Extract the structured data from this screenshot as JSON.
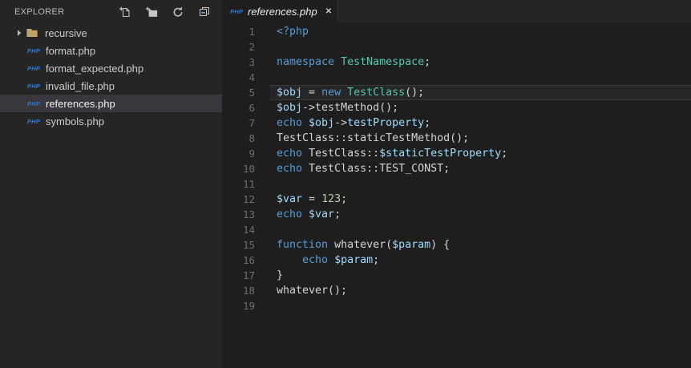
{
  "sidebar": {
    "title": "EXPLORER",
    "php_badge": "PHP",
    "actions": [
      {
        "name": "new-file"
      },
      {
        "name": "new-folder"
      },
      {
        "name": "refresh"
      },
      {
        "name": "collapse-all"
      }
    ],
    "files": [
      {
        "label": "recursive",
        "type": "folder",
        "expanded": false,
        "selected": false
      },
      {
        "label": "format.php",
        "type": "php",
        "selected": false
      },
      {
        "label": "format_expected.php",
        "type": "php",
        "selected": false
      },
      {
        "label": "invalid_file.php",
        "type": "php",
        "selected": false
      },
      {
        "label": "references.php",
        "type": "php",
        "selected": true
      },
      {
        "label": "symbols.php",
        "type": "php",
        "selected": false
      }
    ]
  },
  "tabbar": {
    "tabs": [
      {
        "icon": "PHP",
        "title": "references.php",
        "close": "✕",
        "active": true
      }
    ]
  },
  "editor": {
    "language": "php",
    "current_line": 5,
    "lines": [
      {
        "num": 1,
        "tokens": [
          {
            "c": "keyword",
            "t": "<?php"
          }
        ]
      },
      {
        "num": 2,
        "tokens": []
      },
      {
        "num": 3,
        "tokens": [
          {
            "c": "keyword",
            "t": "namespace "
          },
          {
            "c": "class",
            "t": "TestNamespace"
          },
          {
            "c": "foreground",
            "t": ";"
          }
        ]
      },
      {
        "num": 4,
        "tokens": []
      },
      {
        "num": 5,
        "tokens": [
          {
            "c": "variable",
            "t": "$obj"
          },
          {
            "c": "foreground",
            "t": " = "
          },
          {
            "c": "keyword",
            "t": "new "
          },
          {
            "c": "class",
            "t": "TestClass"
          },
          {
            "c": "foreground",
            "t": "();"
          }
        ]
      },
      {
        "num": 6,
        "tokens": [
          {
            "c": "variable",
            "t": "$obj"
          },
          {
            "c": "foreground",
            "t": "->testMethod();"
          }
        ]
      },
      {
        "num": 7,
        "tokens": [
          {
            "c": "keyword",
            "t": "echo "
          },
          {
            "c": "variable",
            "t": "$obj"
          },
          {
            "c": "foreground",
            "t": "->"
          },
          {
            "c": "variable",
            "t": "testProperty"
          },
          {
            "c": "foreground",
            "t": ";"
          }
        ]
      },
      {
        "num": 8,
        "tokens": [
          {
            "c": "foreground",
            "t": "TestClass::staticTestMethod();"
          }
        ]
      },
      {
        "num": 9,
        "tokens": [
          {
            "c": "keyword",
            "t": "echo "
          },
          {
            "c": "foreground",
            "t": "TestClass::"
          },
          {
            "c": "variable",
            "t": "$staticTestProperty"
          },
          {
            "c": "foreground",
            "t": ";"
          }
        ]
      },
      {
        "num": 10,
        "tokens": [
          {
            "c": "keyword",
            "t": "echo "
          },
          {
            "c": "foreground",
            "t": "TestClass::TEST_CONST;"
          }
        ]
      },
      {
        "num": 11,
        "tokens": []
      },
      {
        "num": 12,
        "tokens": [
          {
            "c": "variable",
            "t": "$var"
          },
          {
            "c": "foreground",
            "t": " = "
          },
          {
            "c": "number",
            "t": "123"
          },
          {
            "c": "foreground",
            "t": ";"
          }
        ]
      },
      {
        "num": 13,
        "tokens": [
          {
            "c": "keyword",
            "t": "echo "
          },
          {
            "c": "variable",
            "t": "$var"
          },
          {
            "c": "foreground",
            "t": ";"
          }
        ]
      },
      {
        "num": 14,
        "tokens": []
      },
      {
        "num": 15,
        "tokens": [
          {
            "c": "keyword",
            "t": "function "
          },
          {
            "c": "foreground",
            "t": "whatever("
          },
          {
            "c": "variable",
            "t": "$param"
          },
          {
            "c": "foreground",
            "t": ") {"
          }
        ]
      },
      {
        "num": 16,
        "tokens": [
          {
            "c": "foreground",
            "t": "    "
          },
          {
            "c": "keyword",
            "t": "echo "
          },
          {
            "c": "variable",
            "t": "$param"
          },
          {
            "c": "foreground",
            "t": ";"
          }
        ]
      },
      {
        "num": 17,
        "tokens": [
          {
            "c": "foreground",
            "t": "}"
          }
        ]
      },
      {
        "num": 18,
        "tokens": [
          {
            "c": "foreground",
            "t": "whatever();"
          }
        ]
      },
      {
        "num": 19,
        "tokens": []
      }
    ]
  },
  "colors": {
    "keyword": "#569CD6",
    "class": "#4EC9B0",
    "variable": "#9CDCFE",
    "number": "#B5CEA8",
    "foreground": "#D4D4D4",
    "php_badge_blue": "#2B7CD6",
    "folder_tan": "#C2A268",
    "sidebar_bg": "#252526",
    "editor_bg": "#1E1E1E",
    "selection_bg": "#37373D"
  }
}
